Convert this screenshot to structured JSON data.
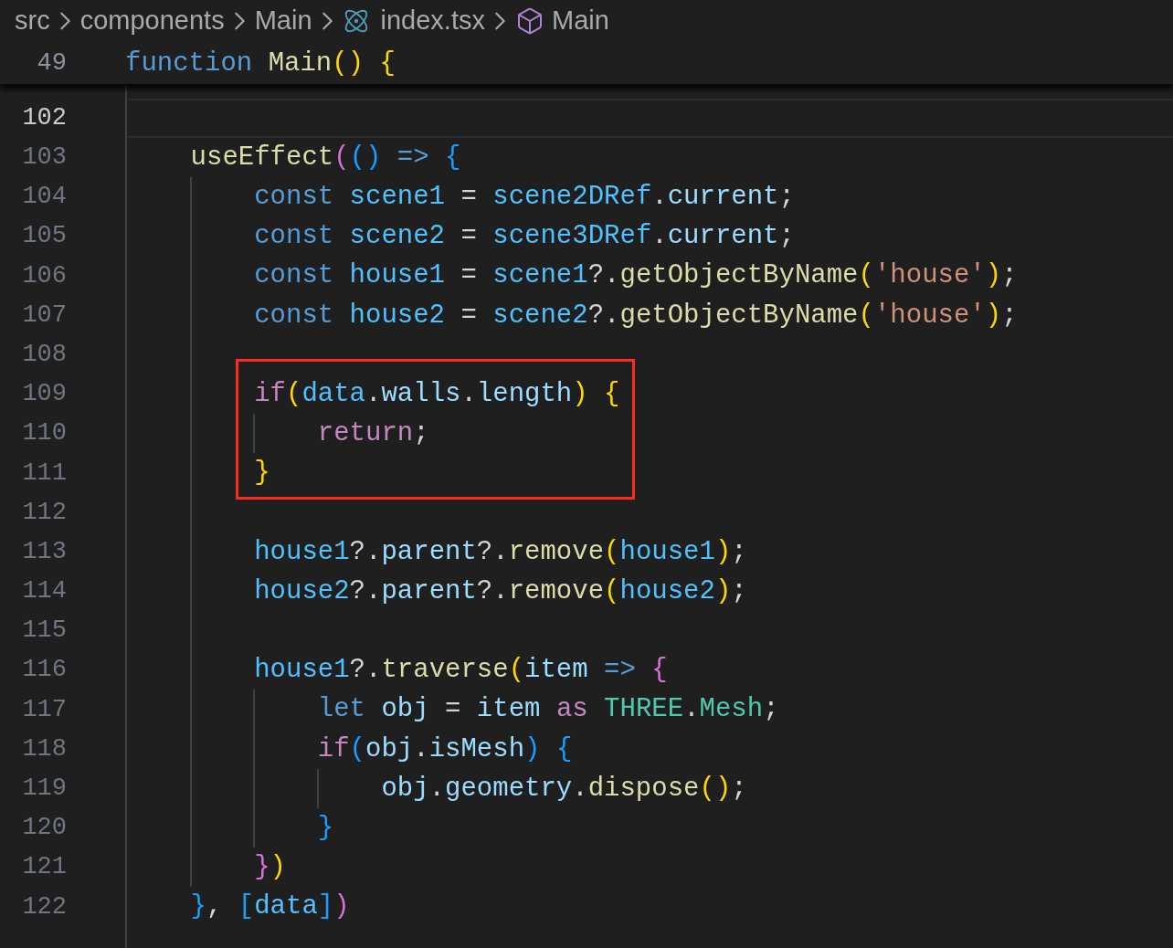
{
  "breadcrumbs": [
    {
      "label": "src",
      "kind": "folder"
    },
    {
      "label": "components",
      "kind": "folder"
    },
    {
      "label": "Main",
      "kind": "folder"
    },
    {
      "label": "index.tsx",
      "kind": "react-file"
    },
    {
      "label": "Main",
      "kind": "symbol"
    }
  ],
  "sticky_line": {
    "number": "49",
    "tokens": [
      {
        "text": "function ",
        "color": "#569cd6"
      },
      {
        "text": "Main",
        "color": "#dcdcaa"
      },
      {
        "text": "() ",
        "color": "#ffd700"
      },
      {
        "text": "{",
        "color": "#ffd700"
      }
    ]
  },
  "lines": [
    {
      "number": "102",
      "current": true,
      "boxed": false
    },
    {
      "number": "103",
      "current": false,
      "boxed": false,
      "tokens": [
        {
          "text": "useEffect",
          "color": "#dcdcaa"
        },
        {
          "text": "(",
          "color": "#da70d6"
        },
        {
          "text": "()",
          "color": "#179fff"
        },
        {
          "text": " => ",
          "color": "#569cd6"
        },
        {
          "text": "{",
          "color": "#179fff"
        }
      ],
      "children": [
        {
          "number": "104",
          "current": false,
          "boxed": false,
          "tokens": [
            {
              "text": "const ",
              "color": "#569cd6"
            },
            {
              "text": "scene1",
              "color": "#4fc1ff"
            },
            {
              "text": " = ",
              "color": "#d4d4d4"
            },
            {
              "text": "scene2DRef",
              "color": "#4fc1ff"
            },
            {
              "text": ".",
              "color": "#d4d4d4"
            },
            {
              "text": "current",
              "color": "#9cdcfe"
            },
            {
              "text": ";",
              "color": "#d4d4d4"
            }
          ]
        },
        {
          "number": "105",
          "current": false,
          "boxed": false,
          "tokens": [
            {
              "text": "const ",
              "color": "#569cd6"
            },
            {
              "text": "scene2",
              "color": "#4fc1ff"
            },
            {
              "text": " = ",
              "color": "#d4d4d4"
            },
            {
              "text": "scene3DRef",
              "color": "#4fc1ff"
            },
            {
              "text": ".",
              "color": "#d4d4d4"
            },
            {
              "text": "current",
              "color": "#9cdcfe"
            },
            {
              "text": ";",
              "color": "#d4d4d4"
            }
          ]
        },
        {
          "number": "106",
          "current": false,
          "boxed": false,
          "tokens": [
            {
              "text": "const ",
              "color": "#569cd6"
            },
            {
              "text": "house1",
              "color": "#4fc1ff"
            },
            {
              "text": " = ",
              "color": "#d4d4d4"
            },
            {
              "text": "scene1",
              "color": "#4fc1ff"
            },
            {
              "text": "?.",
              "color": "#d4d4d4"
            },
            {
              "text": "getObjectByName",
              "color": "#dcdcaa"
            },
            {
              "text": "(",
              "color": "#ffd700"
            },
            {
              "text": "'house'",
              "color": "#ce9178"
            },
            {
              "text": ")",
              "color": "#ffd700"
            },
            {
              "text": ";",
              "color": "#d4d4d4"
            }
          ]
        },
        {
          "number": "107",
          "current": false,
          "boxed": false,
          "tokens": [
            {
              "text": "const ",
              "color": "#569cd6"
            },
            {
              "text": "house2",
              "color": "#4fc1ff"
            },
            {
              "text": " = ",
              "color": "#d4d4d4"
            },
            {
              "text": "scene2",
              "color": "#4fc1ff"
            },
            {
              "text": "?.",
              "color": "#d4d4d4"
            },
            {
              "text": "getObjectByName",
              "color": "#dcdcaa"
            },
            {
              "text": "(",
              "color": "#ffd700"
            },
            {
              "text": "'house'",
              "color": "#ce9178"
            },
            {
              "text": ")",
              "color": "#ffd700"
            },
            {
              "text": ";",
              "color": "#d4d4d4"
            }
          ]
        },
        {
          "number": "108",
          "current": false,
          "boxed": false
        },
        {
          "number": "109",
          "current": false,
          "boxed": true,
          "tokens": [
            {
              "text": "if",
              "color": "#c586c0"
            },
            {
              "text": "(",
              "color": "#ffd700"
            },
            {
              "text": "data",
              "color": "#4fc1ff"
            },
            {
              "text": ".",
              "color": "#d4d4d4"
            },
            {
              "text": "walls",
              "color": "#9cdcfe"
            },
            {
              "text": ".",
              "color": "#d4d4d4"
            },
            {
              "text": "length",
              "color": "#9cdcfe"
            },
            {
              "text": ") ",
              "color": "#ffd700"
            },
            {
              "text": "{",
              "color": "#ffd700"
            }
          ],
          "children": [
            {
              "number": "110",
              "current": false,
              "boxed": true,
              "tokens": [
                {
                  "text": "return",
                  "color": "#c586c0"
                },
                {
                  "text": ";",
                  "color": "#d4d4d4"
                }
              ]
            }
          ]
        },
        {
          "number": "111",
          "current": false,
          "boxed": true,
          "tokens": [
            {
              "text": "}",
              "color": "#ffd700"
            }
          ]
        },
        {
          "number": "112",
          "current": false,
          "boxed": false
        },
        {
          "number": "113",
          "current": false,
          "boxed": false,
          "tokens": [
            {
              "text": "house1",
              "color": "#4fc1ff"
            },
            {
              "text": "?.",
              "color": "#d4d4d4"
            },
            {
              "text": "parent",
              "color": "#9cdcfe"
            },
            {
              "text": "?.",
              "color": "#d4d4d4"
            },
            {
              "text": "remove",
              "color": "#dcdcaa"
            },
            {
              "text": "(",
              "color": "#ffd700"
            },
            {
              "text": "house1",
              "color": "#4fc1ff"
            },
            {
              "text": ")",
              "color": "#ffd700"
            },
            {
              "text": ";",
              "color": "#d4d4d4"
            }
          ]
        },
        {
          "number": "114",
          "current": false,
          "boxed": false,
          "tokens": [
            {
              "text": "house2",
              "color": "#4fc1ff"
            },
            {
              "text": "?.",
              "color": "#d4d4d4"
            },
            {
              "text": "parent",
              "color": "#9cdcfe"
            },
            {
              "text": "?.",
              "color": "#d4d4d4"
            },
            {
              "text": "remove",
              "color": "#dcdcaa"
            },
            {
              "text": "(",
              "color": "#ffd700"
            },
            {
              "text": "house2",
              "color": "#4fc1ff"
            },
            {
              "text": ")",
              "color": "#ffd700"
            },
            {
              "text": ";",
              "color": "#d4d4d4"
            }
          ]
        },
        {
          "number": "115",
          "current": false,
          "boxed": false
        },
        {
          "number": "116",
          "current": false,
          "boxed": false,
          "tokens": [
            {
              "text": "house1",
              "color": "#4fc1ff"
            },
            {
              "text": "?.",
              "color": "#d4d4d4"
            },
            {
              "text": "traverse",
              "color": "#dcdcaa"
            },
            {
              "text": "(",
              "color": "#ffd700"
            },
            {
              "text": "item",
              "color": "#9cdcfe"
            },
            {
              "text": " => ",
              "color": "#569cd6"
            },
            {
              "text": "{",
              "color": "#da70d6"
            }
          ],
          "children": [
            {
              "number": "117",
              "current": false,
              "boxed": false,
              "tokens": [
                {
                  "text": "let ",
                  "color": "#569cd6"
                },
                {
                  "text": "obj",
                  "color": "#9cdcfe"
                },
                {
                  "text": " = ",
                  "color": "#d4d4d4"
                },
                {
                  "text": "item",
                  "color": "#9cdcfe"
                },
                {
                  "text": " as ",
                  "color": "#c586c0"
                },
                {
                  "text": "THREE",
                  "color": "#4ec9b0"
                },
                {
                  "text": ".",
                  "color": "#d4d4d4"
                },
                {
                  "text": "Mesh",
                  "color": "#4ec9b0"
                },
                {
                  "text": ";",
                  "color": "#d4d4d4"
                }
              ]
            },
            {
              "number": "118",
              "current": false,
              "boxed": false,
              "tokens": [
                {
                  "text": "if",
                  "color": "#c586c0"
                },
                {
                  "text": "(",
                  "color": "#179fff"
                },
                {
                  "text": "obj",
                  "color": "#9cdcfe"
                },
                {
                  "text": ".",
                  "color": "#d4d4d4"
                },
                {
                  "text": "isMesh",
                  "color": "#9cdcfe"
                },
                {
                  "text": ") ",
                  "color": "#179fff"
                },
                {
                  "text": "{",
                  "color": "#179fff"
                }
              ],
              "children": [
                {
                  "number": "119",
                  "current": false,
                  "boxed": false,
                  "tokens": [
                    {
                      "text": "obj",
                      "color": "#9cdcfe"
                    },
                    {
                      "text": ".",
                      "color": "#d4d4d4"
                    },
                    {
                      "text": "geometry",
                      "color": "#9cdcfe"
                    },
                    {
                      "text": ".",
                      "color": "#d4d4d4"
                    },
                    {
                      "text": "dispose",
                      "color": "#dcdcaa"
                    },
                    {
                      "text": "()",
                      "color": "#ffd700"
                    },
                    {
                      "text": ";",
                      "color": "#d4d4d4"
                    }
                  ]
                }
              ]
            },
            {
              "number": "120",
              "current": false,
              "boxed": false,
              "tokens": [
                {
                  "text": "}",
                  "color": "#179fff"
                }
              ]
            }
          ]
        },
        {
          "number": "121",
          "current": false,
          "boxed": false,
          "tokens": [
            {
              "text": "}",
              "color": "#da70d6"
            },
            {
              "text": ")",
              "color": "#ffd700"
            }
          ]
        }
      ]
    },
    {
      "number": "122",
      "current": false,
      "boxed": false,
      "tokens": [
        {
          "text": "}",
          "color": "#179fff"
        },
        {
          "text": ", ",
          "color": "#d4d4d4"
        },
        {
          "text": "[",
          "color": "#179fff"
        },
        {
          "text": "data",
          "color": "#4fc1ff"
        },
        {
          "text": "]",
          "color": "#179fff"
        },
        {
          "text": ")",
          "color": "#da70d6"
        }
      ]
    }
  ]
}
